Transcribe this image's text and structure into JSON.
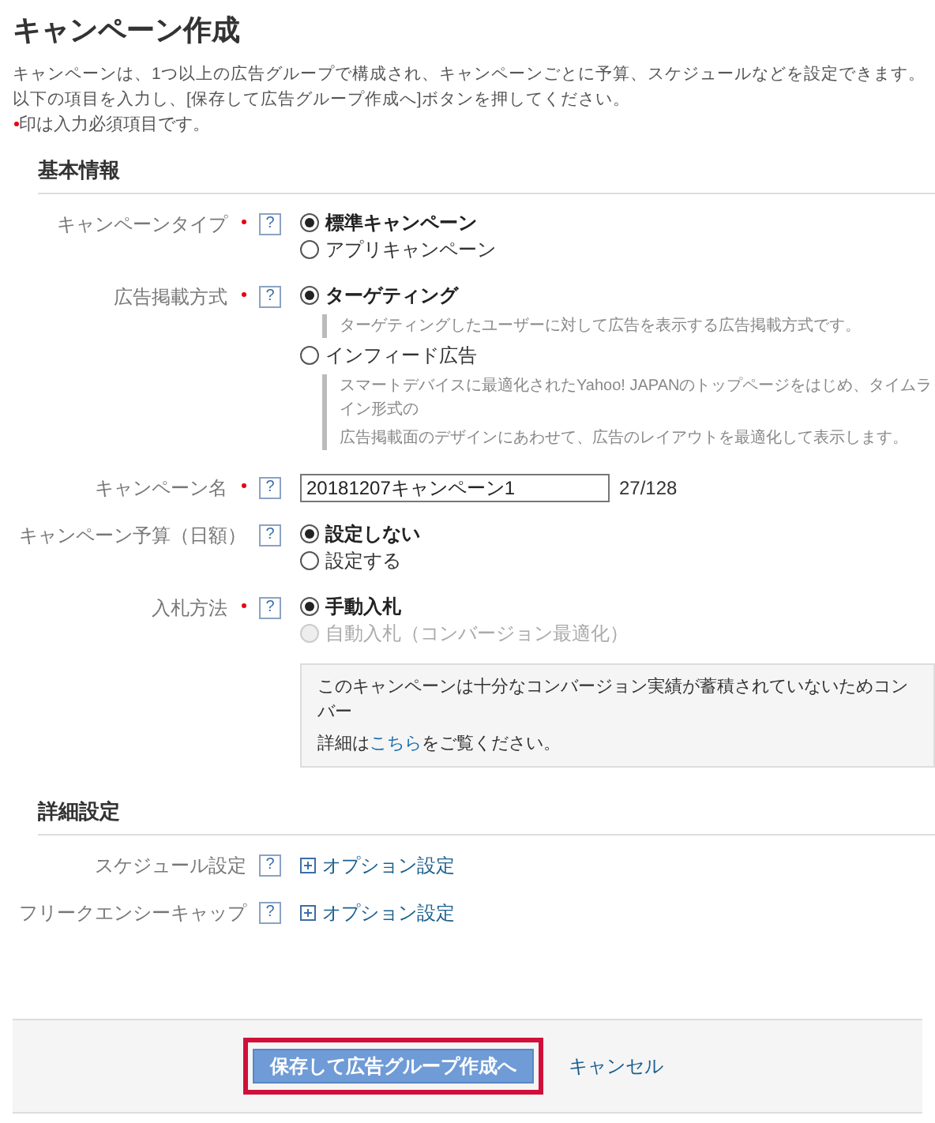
{
  "title": "キャンペーン作成",
  "intro": [
    "キャンペーンは、1つ以上の広告グループで構成され、キャンペーンごとに予算、スケジュールなどを設定できます。",
    "以下の項目を入力し、[保存して広告グループ作成へ]ボタンを押してください。"
  ],
  "required_note": "印は入力必須項目です。",
  "sections": [
    {
      "title": "基本情報",
      "rows": [
        {
          "kind": "radio",
          "label": "キャンペーンタイプ",
          "required": true,
          "help": "?",
          "options": [
            {
              "label": "標準キャンペーン",
              "selected": true,
              "disabled": false
            },
            {
              "label": "アプリキャンペーン",
              "selected": false,
              "disabled": false
            }
          ]
        },
        {
          "kind": "radio",
          "label": "広告掲載方式",
          "required": true,
          "help": "?",
          "options": [
            {
              "label": "ターゲティング",
              "selected": true,
              "disabled": false,
              "description": [
                "ターゲティングしたユーザーに対して広告を表示する広告掲載方式です。"
              ]
            },
            {
              "label": "インフィード広告",
              "selected": false,
              "disabled": false,
              "description": [
                "スマートデバイスに最適化されたYahoo! JAPANのトップページをはじめ、タイムライン形式の",
                "広告掲載面のデザインにあわせて、広告のレイアウトを最適化して表示します。"
              ]
            }
          ]
        },
        {
          "kind": "text",
          "label": "キャンペーン名",
          "required": true,
          "help": "?",
          "value": "20181207キャンペーン1",
          "counter": "27/128"
        },
        {
          "kind": "radio",
          "label": "キャンペーン予算（日額）",
          "required": false,
          "help": "?",
          "options": [
            {
              "label": "設定しない",
              "selected": true,
              "disabled": false
            },
            {
              "label": "設定する",
              "selected": false,
              "disabled": false
            }
          ]
        },
        {
          "kind": "radio",
          "label": "入札方法",
          "required": true,
          "help": "?",
          "options": [
            {
              "label": "手動入札",
              "selected": true,
              "disabled": false
            },
            {
              "label": "自動入札（コンバージョン最適化）",
              "selected": false,
              "disabled": true
            }
          ],
          "info": {
            "text": "このキャンペーンは十分なコンバージョン実績が蓄積されていないためコンバー",
            "before": "詳細は",
            "link": "こちら",
            "after": "をご覧ください。"
          }
        }
      ]
    },
    {
      "title": "詳細設定",
      "rows": [
        {
          "kind": "option",
          "label": "スケジュール設定",
          "required": false,
          "help": "?",
          "link": "オプション設定"
        },
        {
          "kind": "option",
          "label": "フリークエンシーキャップ",
          "required": false,
          "help": "?",
          "link": "オプション設定"
        }
      ]
    }
  ],
  "footer": {
    "submit": {
      "label": "保存して広告グループ作成へ",
      "highlighted": true
    },
    "cancel": "キャンセル"
  }
}
